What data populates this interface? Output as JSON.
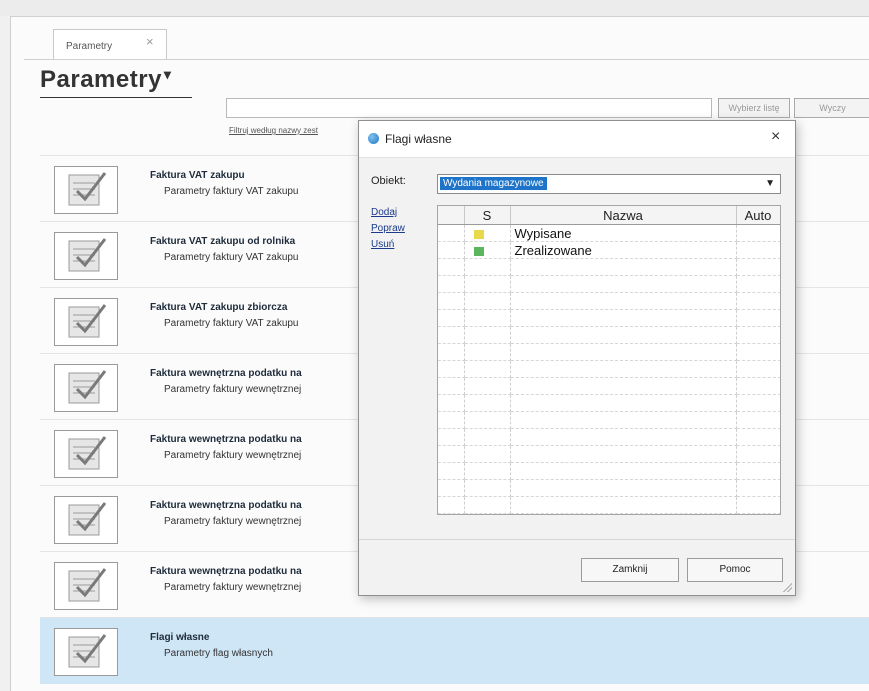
{
  "tab": {
    "label": "Parametry",
    "close": "×"
  },
  "page": {
    "title": "Parametry",
    "title_caret": "▾"
  },
  "filter": {
    "hint": "Filtruj według nazwy zest",
    "select_button": "Wybierz listę",
    "clear_button": "Wyczy"
  },
  "items": [
    {
      "title": "Faktura VAT zakupu",
      "desc": "Parametry faktury VAT zakupu"
    },
    {
      "title": "Faktura VAT zakupu od rolnika",
      "desc": "Parametry faktury VAT zakupu"
    },
    {
      "title": "Faktura VAT zakupu zbiorcza",
      "desc": "Parametry faktury VAT zakupu"
    },
    {
      "title": "Faktura wewnętrzna podatku na",
      "desc": "Parametry faktury wewnętrznej"
    },
    {
      "title": "Faktura wewnętrzna podatku na",
      "desc": "Parametry faktury wewnętrznej"
    },
    {
      "title": "Faktura wewnętrzna podatku na",
      "desc": "Parametry faktury wewnętrznej"
    },
    {
      "title": "Faktura wewnętrzna podatku na",
      "desc": "Parametry faktury wewnętrznej"
    },
    {
      "title": "Flagi własne",
      "desc": "Parametry flag własnych",
      "selected": true
    }
  ],
  "dialog": {
    "title": "Flagi własne",
    "close": "×",
    "object_label": "Obiekt:",
    "object_value": "Wydania magazynowe",
    "links": {
      "add": "Dodaj",
      "edit": "Popraw",
      "delete": "Usuń"
    },
    "columns": {
      "s": "S",
      "name": "Nazwa",
      "auto": "Auto"
    },
    "rows": [
      {
        "name": "Wypisane",
        "flag_color": "#e8d84a"
      },
      {
        "name": "Zrealizowane",
        "flag_color": "#5db65d"
      }
    ],
    "close_button": "Zamknij",
    "help_button": "Pomoc"
  },
  "colors": {
    "selected_row": "#cfe6f7",
    "dropdown_highlight": "#1e74c9"
  }
}
